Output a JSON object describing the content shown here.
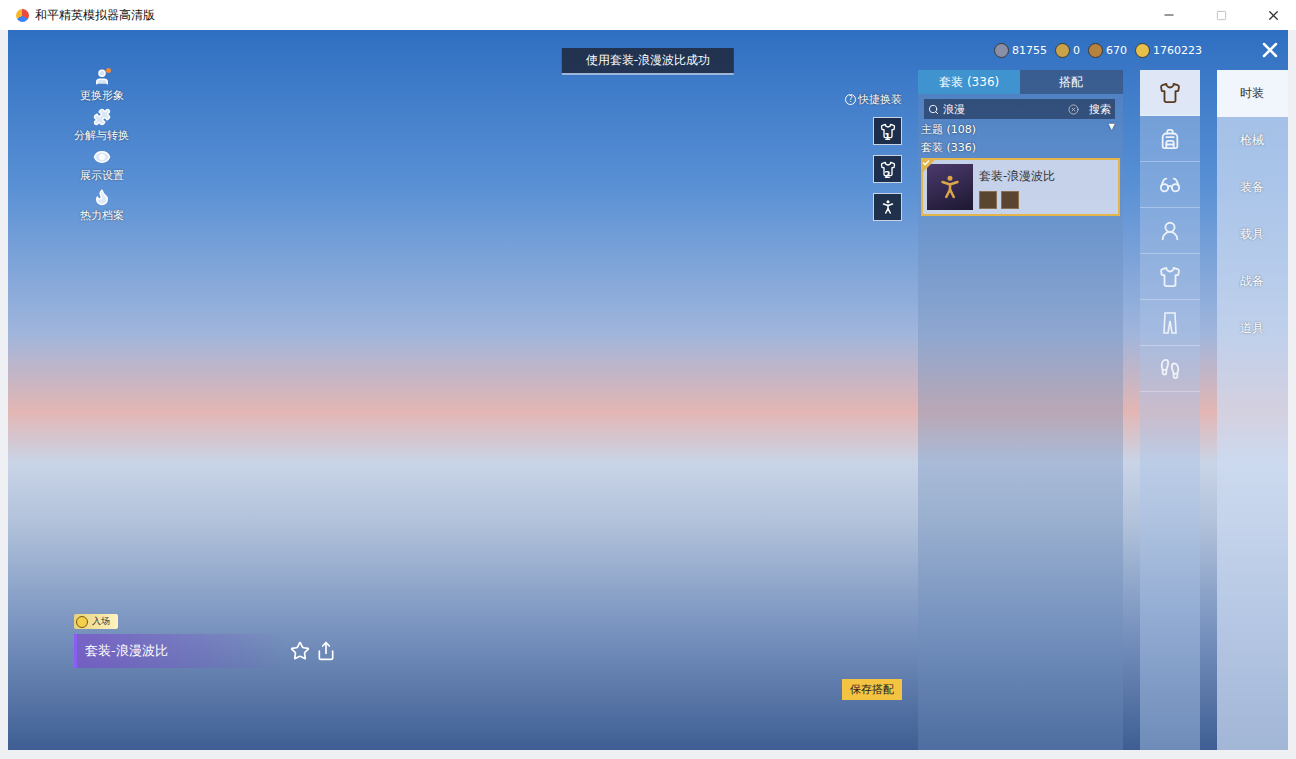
{
  "window": {
    "title": "和平精英模拟器高清版"
  },
  "toast": "使用套装-浪漫波比成功",
  "left_menu": [
    {
      "label": "更换形象",
      "badge": true
    },
    {
      "label": "分解与转换",
      "badge": false
    },
    {
      "label": "展示设置",
      "badge": false
    },
    {
      "label": "热力档案",
      "badge": false
    }
  ],
  "currencies": [
    {
      "amount": "81755",
      "color": "#8a8fa8"
    },
    {
      "amount": "0",
      "color": "#c9a24a"
    },
    {
      "amount": "670",
      "color": "#b7823e"
    },
    {
      "amount": "1760223",
      "color": "#e6c04a"
    }
  ],
  "panel": {
    "tabs": [
      {
        "label": "套装 (336)",
        "selected": true
      },
      {
        "label": "搭配",
        "selected": false
      }
    ],
    "search": {
      "value": "浪漫",
      "button": "搜索"
    },
    "groups": [
      {
        "label": "主题 (108)",
        "expandable": true
      },
      {
        "label": "套装 (336)",
        "expandable": false
      }
    ],
    "items": [
      {
        "name": "套装-浪漫波比",
        "selected": true,
        "equipped": true
      }
    ]
  },
  "quick_change": {
    "label": "快捷换装",
    "help": "?",
    "slots": [
      "1",
      "2"
    ]
  },
  "subcategories": [
    {
      "selected": true
    },
    {
      "selected": false
    },
    {
      "selected": false
    },
    {
      "selected": false
    },
    {
      "selected": false
    },
    {
      "selected": false
    },
    {
      "selected": false
    }
  ],
  "categories": [
    {
      "label": "时装",
      "selected": true
    },
    {
      "label": "枪械",
      "selected": false
    },
    {
      "label": "装备",
      "selected": false
    },
    {
      "label": "载具",
      "selected": false
    },
    {
      "label": "战备",
      "selected": false
    },
    {
      "label": "道具",
      "selected": false
    }
  ],
  "outfit": {
    "tag": "入场",
    "name": "套装-浪漫波比"
  },
  "save_button": "保存搭配"
}
